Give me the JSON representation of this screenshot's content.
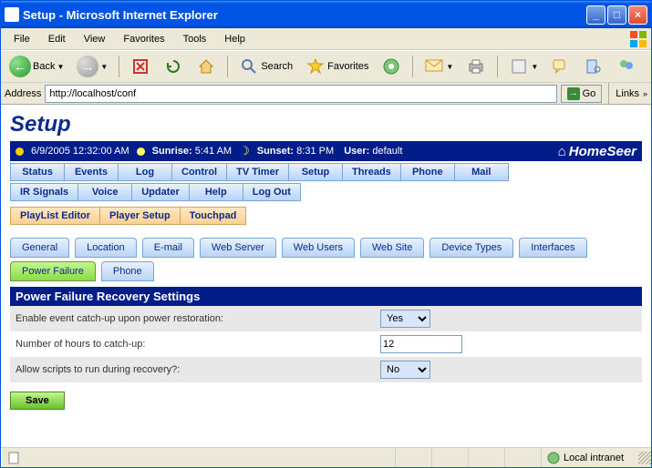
{
  "window": {
    "title": "Setup - Microsoft Internet Explorer"
  },
  "menu": [
    "File",
    "Edit",
    "View",
    "Favorites",
    "Tools",
    "Help"
  ],
  "toolbar": {
    "back": "Back",
    "search": "Search",
    "favorites": "Favorites"
  },
  "address": {
    "label": "Address",
    "url": "http://localhost/conf",
    "go": "Go",
    "links": "Links"
  },
  "page": {
    "title": "Setup"
  },
  "statusline": {
    "datetime": "6/9/2005 12:32:00 AM",
    "sunrise_label": "Sunrise:",
    "sunrise": "5:41 AM",
    "sunset_label": "Sunset:",
    "sunset": "8:31 PM",
    "user_label": "User:",
    "user": "default",
    "brand": "HomeSeer"
  },
  "main_tabs_row1": [
    "Status",
    "Events",
    "Log",
    "Control",
    "TV Timer",
    "Setup",
    "Threads",
    "Phone",
    "Mail"
  ],
  "main_tabs_row2": [
    "IR Signals",
    "Voice",
    "Updater",
    "Help",
    "Log Out"
  ],
  "orange_tabs": [
    "PlayList Editor",
    "Player Setup",
    "Touchpad"
  ],
  "config_tabs_row1": [
    "General",
    "Location",
    "E-mail",
    "Web Server",
    "Web Users",
    "Web Site",
    "Device Types",
    "Interfaces"
  ],
  "config_tabs_row2": [
    "Power Failure",
    "Phone"
  ],
  "panel": {
    "title": "Power Failure Recovery Settings",
    "rows": {
      "enable": {
        "label": "Enable event catch-up upon power restoration:",
        "value": "Yes"
      },
      "hours": {
        "label": "Number of hours to catch-up:",
        "value": "12"
      },
      "scripts": {
        "label": "Allow scripts to run during recovery?:",
        "value": "No"
      }
    },
    "save": "Save"
  },
  "status": {
    "zone": "Local intranet"
  }
}
